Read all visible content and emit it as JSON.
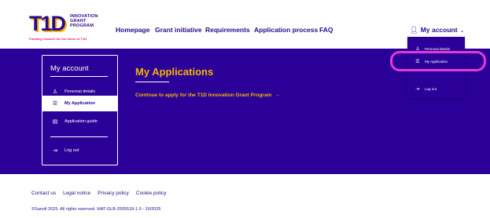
{
  "brand": {
    "mark": "T1D",
    "words": [
      "INNOVATION",
      "GRANT",
      "PROGRAM"
    ],
    "tagline": "Funding research for the future of T1D",
    "primary_color": "#2a0099",
    "accent_color": "#f7b500",
    "highlight_color": "#e53ad7"
  },
  "nav": {
    "items": [
      "Homepage",
      "Grant initiative",
      "Requirements",
      "Application process",
      "FAQ"
    ]
  },
  "account": {
    "label": "My account",
    "icon": "person-icon",
    "chevron": "chevron-down-icon"
  },
  "dropdown": {
    "items": [
      {
        "label": "Personal details",
        "icon": "person-icon"
      },
      {
        "label": "My Application",
        "icon": "document-icon"
      },
      {
        "label": "Log out",
        "icon": "logout-icon"
      }
    ]
  },
  "sidebar": {
    "title": "My account",
    "items": [
      {
        "label": "Personal details",
        "icon": "person-icon",
        "active": false
      },
      {
        "label": "My Application",
        "icon": "document-icon",
        "active": true
      },
      {
        "label": "Application guide",
        "icon": "folder-icon",
        "active": false
      },
      {
        "label": "Log out",
        "icon": "logout-icon",
        "active": false
      }
    ]
  },
  "main": {
    "title": "My Applications",
    "cta": "Continue to apply for the T1D Innovation Grant Program",
    "cta_arrow": "→"
  },
  "footer": {
    "links": [
      "Contact us",
      "Legal notice",
      "Privacy policy",
      "Cookie policy"
    ],
    "copyright": "©Sanofi 2025. All rights reserved. MAT-GLB-2505518-1.0 - 10/2025"
  }
}
